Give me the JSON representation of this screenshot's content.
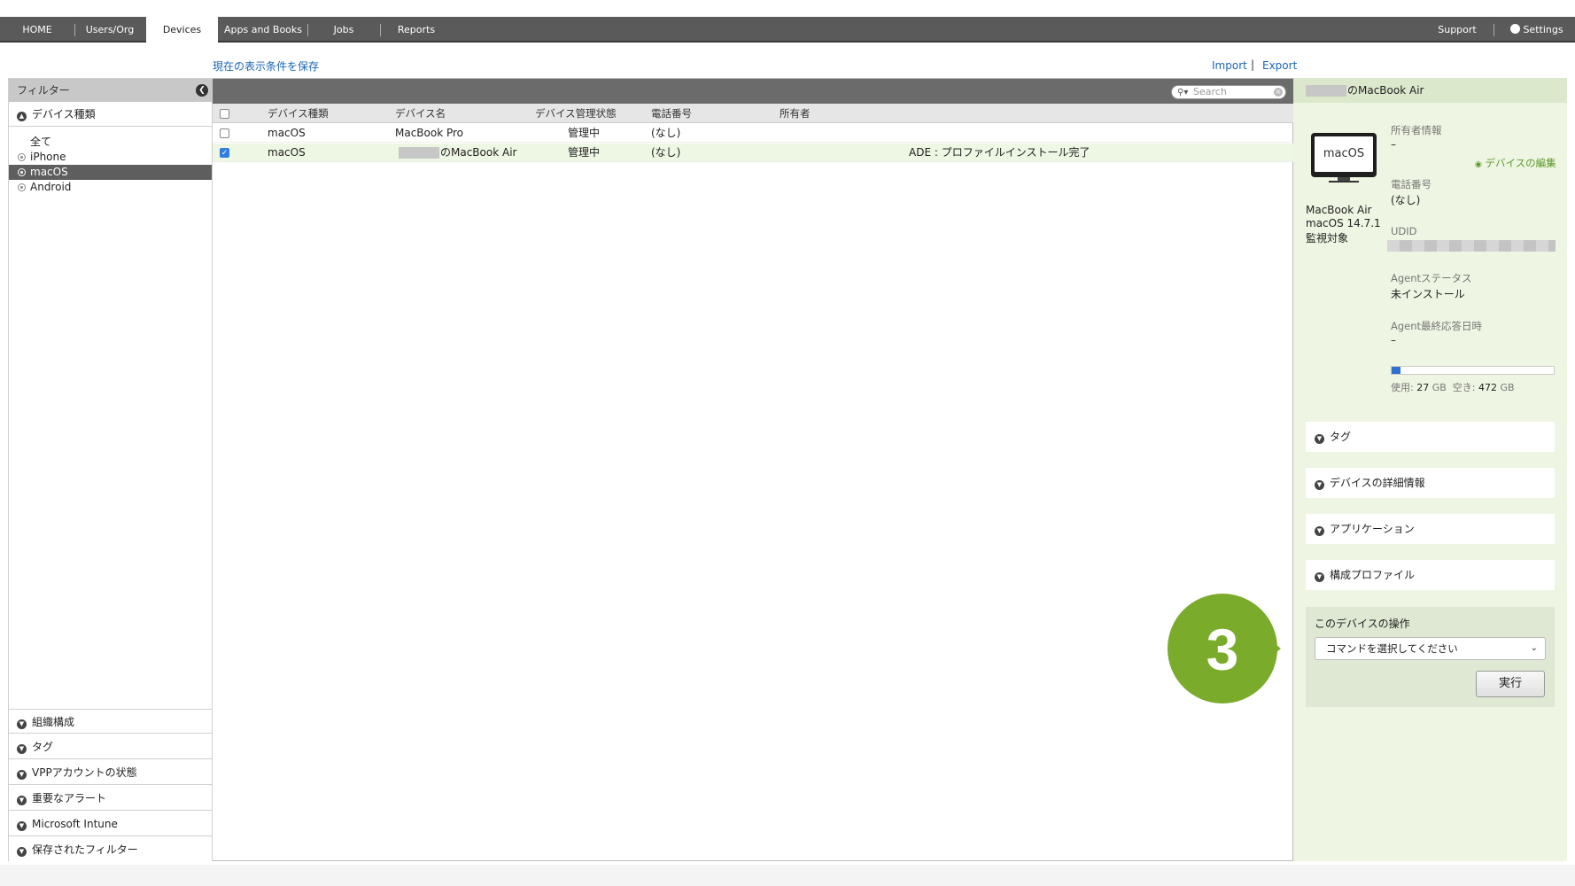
{
  "nav": {
    "tabs": [
      {
        "label": "HOME"
      },
      {
        "label": "Users/Org"
      },
      {
        "label": "Devices"
      },
      {
        "label": "Apps and Books"
      },
      {
        "label": "Jobs"
      },
      {
        "label": "Reports"
      }
    ],
    "active_tab": "Devices",
    "support_label": "Support",
    "settings_label": "Settings"
  },
  "toolbar": {
    "save_view_label": "現在の表示条件を保存",
    "import_label": "Import",
    "divider": "|",
    "export_label": "Export"
  },
  "sidebar": {
    "title": "フィルター",
    "collapse_icon": "chevron-left-icon",
    "device_type_section": "デバイス種類",
    "all_label": "全て",
    "items": [
      {
        "label": "iPhone",
        "selected": false
      },
      {
        "label": "macOS",
        "selected": true
      },
      {
        "label": "Android",
        "selected": false
      }
    ],
    "bottom_sections": [
      {
        "label": "組織構成"
      },
      {
        "label": "タグ"
      },
      {
        "label": "VPPアカウントの状態"
      },
      {
        "label": "重要なアラート"
      },
      {
        "label": "Microsoft Intune"
      },
      {
        "label": "保存されたフィルター"
      }
    ]
  },
  "table": {
    "search_placeholder": "Search",
    "columns": [
      "デバイス種類",
      "デバイス名",
      "デバイス管理状態",
      "電話番号",
      "所有者"
    ],
    "rows": [
      {
        "checked": false,
        "type": "macOS",
        "name": "MacBook Pro",
        "status": "管理中",
        "phone": "(なし)",
        "owner": "",
        "note": ""
      },
      {
        "checked": true,
        "type": "macOS",
        "name": "のMacBook Air",
        "status": "管理中",
        "phone": "(なし)",
        "owner": "",
        "note": "ADE : プロファイルインストール完了"
      }
    ]
  },
  "detail": {
    "header": "のMacBook Air",
    "device_icon_label": "macOS",
    "model": "MacBook Air",
    "os": "macOS 14.7.1",
    "supervised": "監視対象",
    "owner_label": "所有者情報",
    "owner_value": "–",
    "edit_label": "デバイスの編集",
    "phone_label": "電話番号",
    "phone_value": "(なし)",
    "udid_label": "UDID",
    "agent_status_label": "Agentステータス",
    "agent_status_value": "未インストール",
    "agent_last_label": "Agent最終応答日時",
    "agent_last_value": "–",
    "storage_used_label": "使用:",
    "storage_used_value": "27",
    "storage_unit": "GB",
    "storage_free_label": "空き:",
    "storage_free_value": "472",
    "storage_used_fraction": 0.054,
    "accordions": [
      {
        "label": "タグ"
      },
      {
        "label": "デバイスの詳細情報"
      },
      {
        "label": "アプリケーション"
      },
      {
        "label": "構成プロファイル"
      }
    ],
    "ops_title": "このデバイスの操作",
    "ops_select_value": "コマンドを選択してください",
    "run_label": "実行"
  },
  "callout": {
    "number": "3",
    "color": "#7aab2a"
  },
  "colors": {
    "nav_bg": "#5a5a5a",
    "link": "#1a66b5",
    "detail_bg": "#eef5e2",
    "accent_green": "#7aab2a",
    "storage_bar": "#2f6fd0"
  }
}
